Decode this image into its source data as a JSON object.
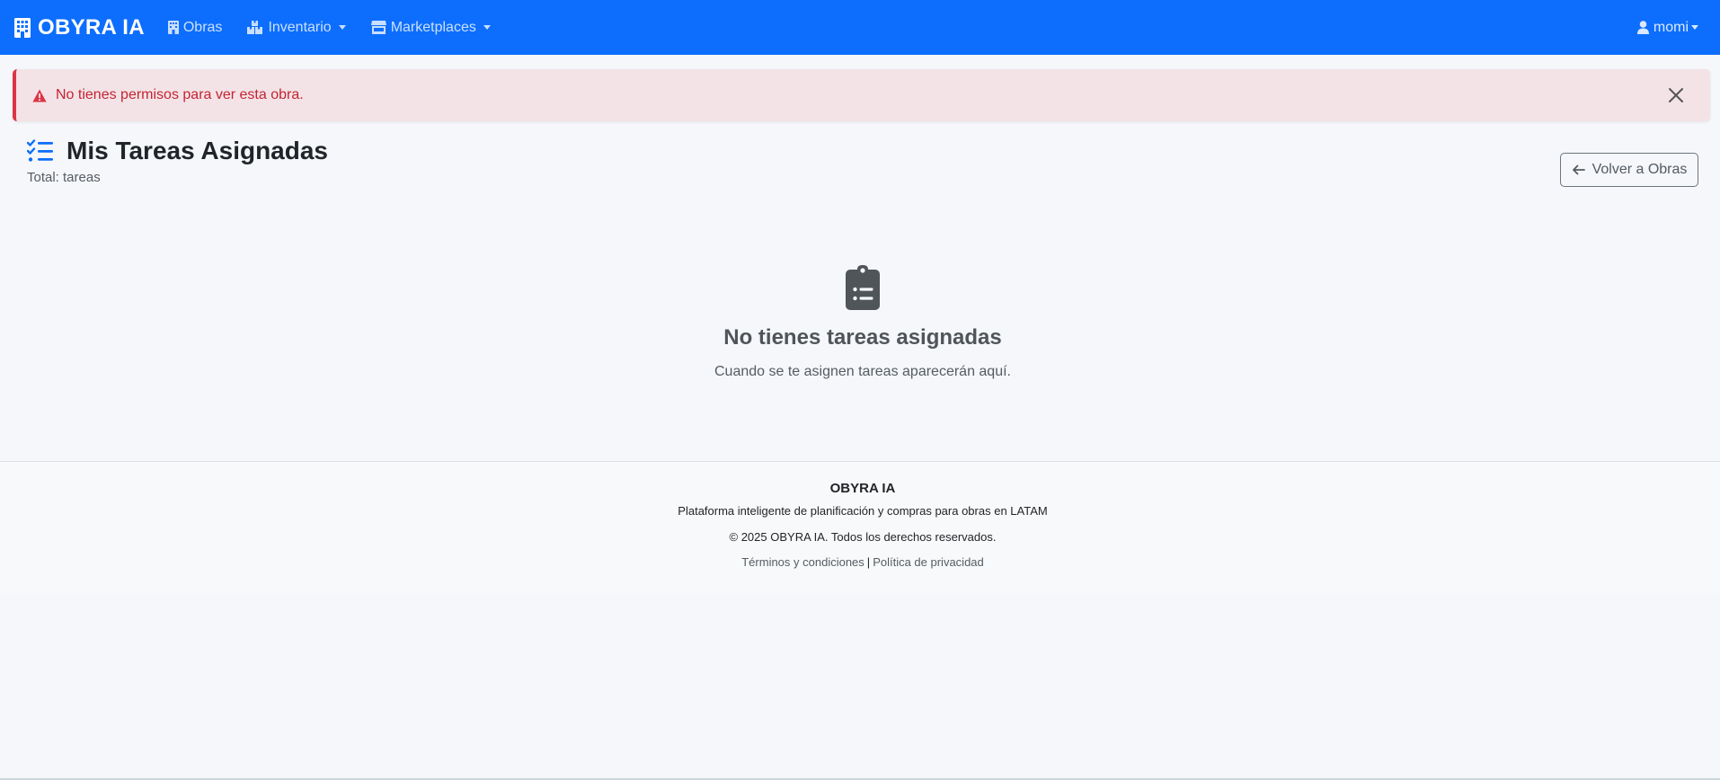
{
  "navbar": {
    "brand": "OBYRA IA",
    "items": [
      {
        "label": "Obras",
        "icon": "building-icon",
        "dropdown": false
      },
      {
        "label": "Inventario",
        "icon": "boxes-icon",
        "dropdown": true
      },
      {
        "label": "Marketplaces",
        "icon": "store-icon",
        "dropdown": true
      }
    ],
    "user": "momi"
  },
  "alert": {
    "type": "danger",
    "message": "No tienes permisos para ver esta obra.",
    "icon": "warning-triangle-icon"
  },
  "header": {
    "title": "Mis Tareas Asignadas",
    "subtitle": "Total: tareas",
    "icon": "task-list-icon",
    "back_button": "Volver a Obras"
  },
  "empty_state": {
    "icon": "clipboard-list-icon",
    "title": "No tienes tareas asignadas",
    "text": "Cuando se te asignen tareas aparecerán aquí."
  },
  "footer": {
    "brand": "OBYRA IA",
    "tagline": "Plataforma inteligente de planificación y compras para obras en LATAM",
    "copyright": "© 2025 OBYRA IA. Todos los derechos reservados.",
    "links": [
      "Términos y condiciones",
      "Política de privacidad"
    ],
    "separator": "|"
  },
  "colors": {
    "primary": "#0d6efd",
    "danger": "#dc3545",
    "alert_bg": "#f3e3e6",
    "page_bg": "#f5f7fa"
  }
}
